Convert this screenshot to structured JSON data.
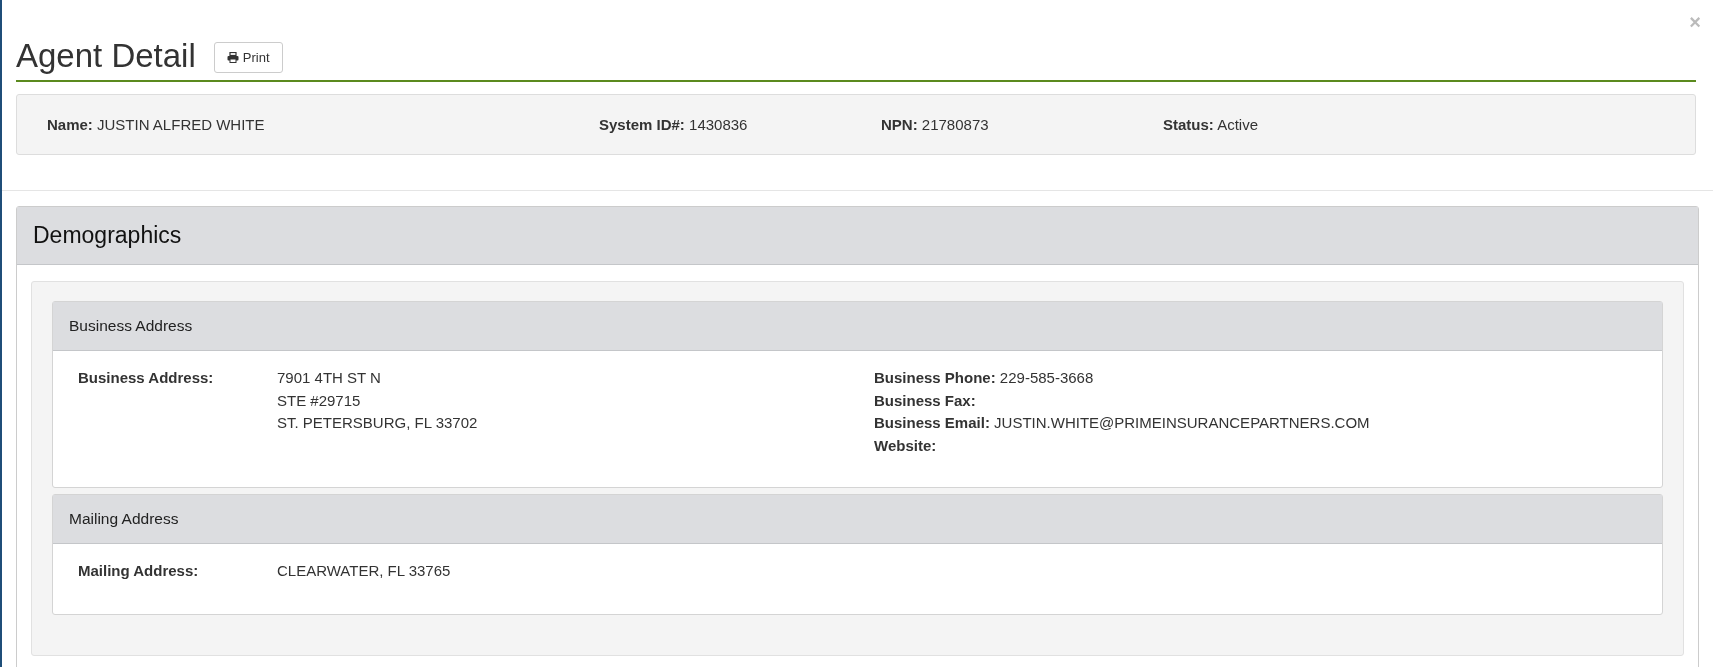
{
  "close": "×",
  "header": {
    "title": "Agent Detail",
    "print_button": "Print"
  },
  "summary": [
    {
      "label": "Name:",
      "value": "JUSTIN ALFRED WHITE"
    },
    {
      "label": "System ID#:",
      "value": "1430836"
    },
    {
      "label": "NPN:",
      "value": "21780873"
    },
    {
      "label": "Status:",
      "value": "Active"
    }
  ],
  "section": {
    "title": "Demographics",
    "panels": [
      {
        "title": "Business Address",
        "address_label": "Business Address:",
        "address_lines": [
          "7901 4TH ST N",
          "STE #29715",
          "ST. PETERSBURG, FL 33702"
        ],
        "contacts": [
          {
            "label": "Business Phone:",
            "value": "229-585-3668"
          },
          {
            "label": "Business Fax:"
          },
          {
            "label": "Business Email:",
            "value": "JUSTIN.WHITE@PRIMEINSURANCEPARTNERS.COM"
          },
          {
            "label": "Website:"
          }
        ]
      },
      {
        "title": "Mailing Address",
        "address_label": "Mailing Address:",
        "address_lines": [
          "CLEARWATER, FL 33765"
        ]
      }
    ]
  }
}
